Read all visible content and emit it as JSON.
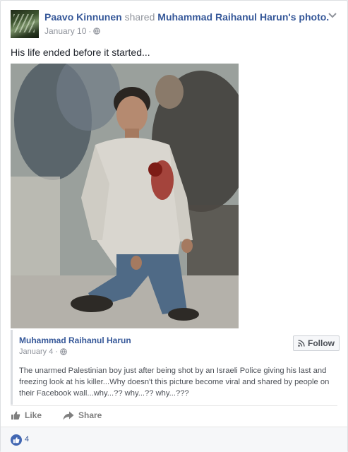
{
  "post": {
    "author": "Paavo Kinnunen",
    "shared_word": " shared ",
    "original_author": "Muhammad Raihanul Harun",
    "photo_word": "'s photo.",
    "date": "January 10",
    "separator": "·",
    "text": "His life ended before it started..."
  },
  "quoted": {
    "author": "Muhammad Raihanul Harun",
    "date": "January 4",
    "separator": "·",
    "follow_label": "Follow",
    "body": "The unarmed Palestinian boy just after being shot by an Israeli Police giving his last and freezing look at his killer...Why doesn't this picture become viral and shared by people on their Facebook wall...why...?? why...?? why...???"
  },
  "actions": {
    "like_label": "Like",
    "share_label": "Share"
  },
  "reactions": {
    "count": "4"
  },
  "colors": {
    "link_blue": "#365899",
    "meta_gray": "#90949c",
    "like_blue": "#4267b2"
  },
  "icons": [
    "globe-icon",
    "chevron-down-icon",
    "rss-icon",
    "thumbs-up-icon",
    "share-arrow-icon"
  ]
}
